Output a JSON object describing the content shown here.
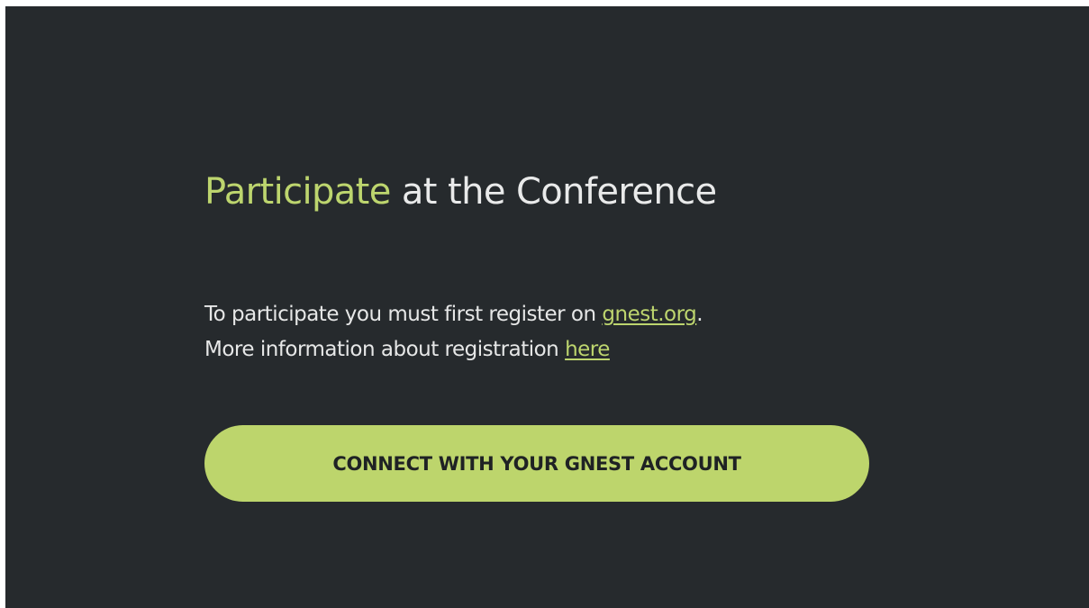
{
  "heading": {
    "accent_word": "Participate",
    "rest": " at the Conference"
  },
  "info": {
    "line1_prefix": "To participate you must first register on ",
    "line1_link": "gnest.org",
    "line1_suffix": ".",
    "line2_prefix": "More information about registration ",
    "line2_link": "here"
  },
  "cta": {
    "label": "CONNECT WITH YOUR GNEST ACCOUNT"
  },
  "colors": {
    "background": "#262a2d",
    "accent": "#bdd56e",
    "text": "#e9eaea"
  }
}
